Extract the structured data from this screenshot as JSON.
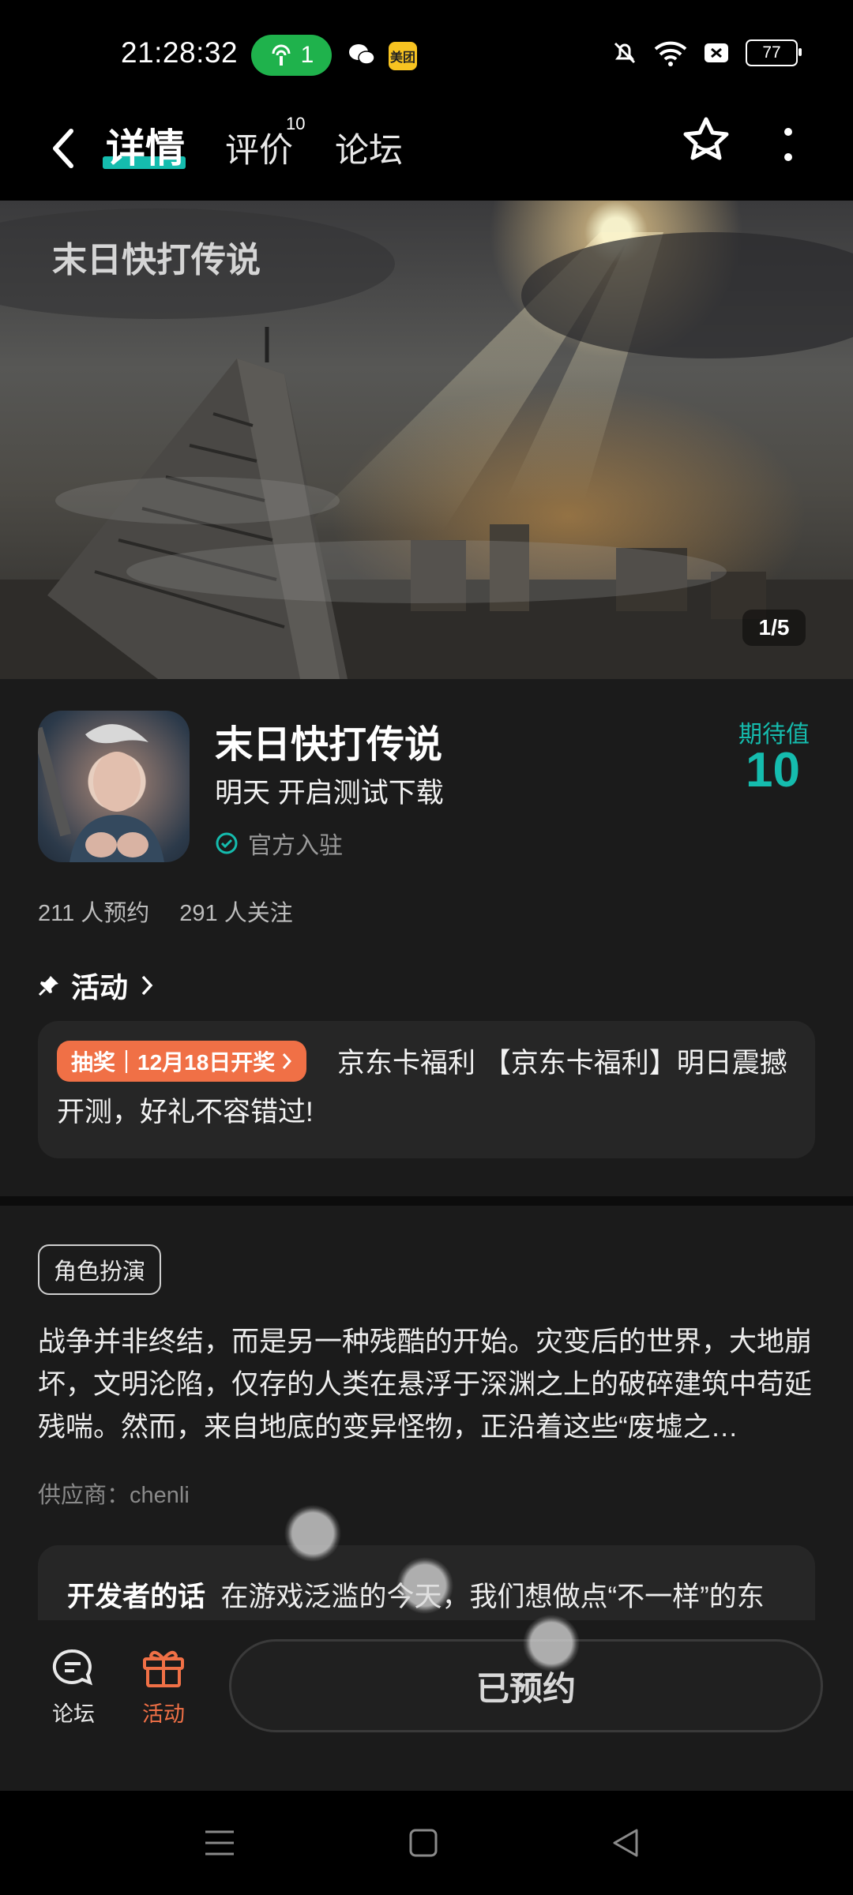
{
  "status_bar": {
    "time": "21:28:32",
    "hotspot_count": "1",
    "meituan_badge": "美团",
    "battery": "77",
    "icons": [
      "hotspot-icon",
      "wechat-icon",
      "meituan-icon",
      "mute-icon",
      "wifi-icon",
      "no-sim-icon",
      "battery-icon"
    ]
  },
  "header": {
    "tabs": [
      {
        "label": "详情",
        "active": true
      },
      {
        "label": "评价",
        "badge": "10"
      },
      {
        "label": "论坛"
      }
    ],
    "icons": [
      "back-arrow-icon",
      "star-favorite-icon",
      "more-vertical-icon"
    ]
  },
  "banner": {
    "counter": "1/5",
    "logo_text": "末日快打传说"
  },
  "app": {
    "name": "末日快打传说",
    "subtitle": "明天 开启测试下载",
    "verified_label": "官方入驻",
    "expect_label": "期待值",
    "expect_value": "10",
    "reservations": "211 人预约",
    "followers": "291 人关注"
  },
  "activity": {
    "title": "活动",
    "tag": "抽奖｜12月18日开奖",
    "text": "京东卡福利 【京东卡福利】明日震撼开测，好礼不容错过!"
  },
  "details": {
    "genre": "角色扮演",
    "description": "战争并非终结，而是另一种残酷的开始。灾变后的世界，大地崩坏，文明沦陷，仅存的人类在悬浮于深渊之上的破碎建筑中苟延残喘。然而，来自地底的变异怪物，正沿着这些“废墟之…",
    "supplier": "供应商：chenli",
    "developer_label": "开发者的话",
    "developer_text": "在游戏泛滥的今天，我们想做点“不一样”的东"
  },
  "bottom_bar": {
    "forum_label": "论坛",
    "activity_label": "活动",
    "reserve_button": "已预约"
  },
  "colors": {
    "accent": "#15bcae",
    "orange": "#f07046",
    "background": "#1b1b1b"
  }
}
